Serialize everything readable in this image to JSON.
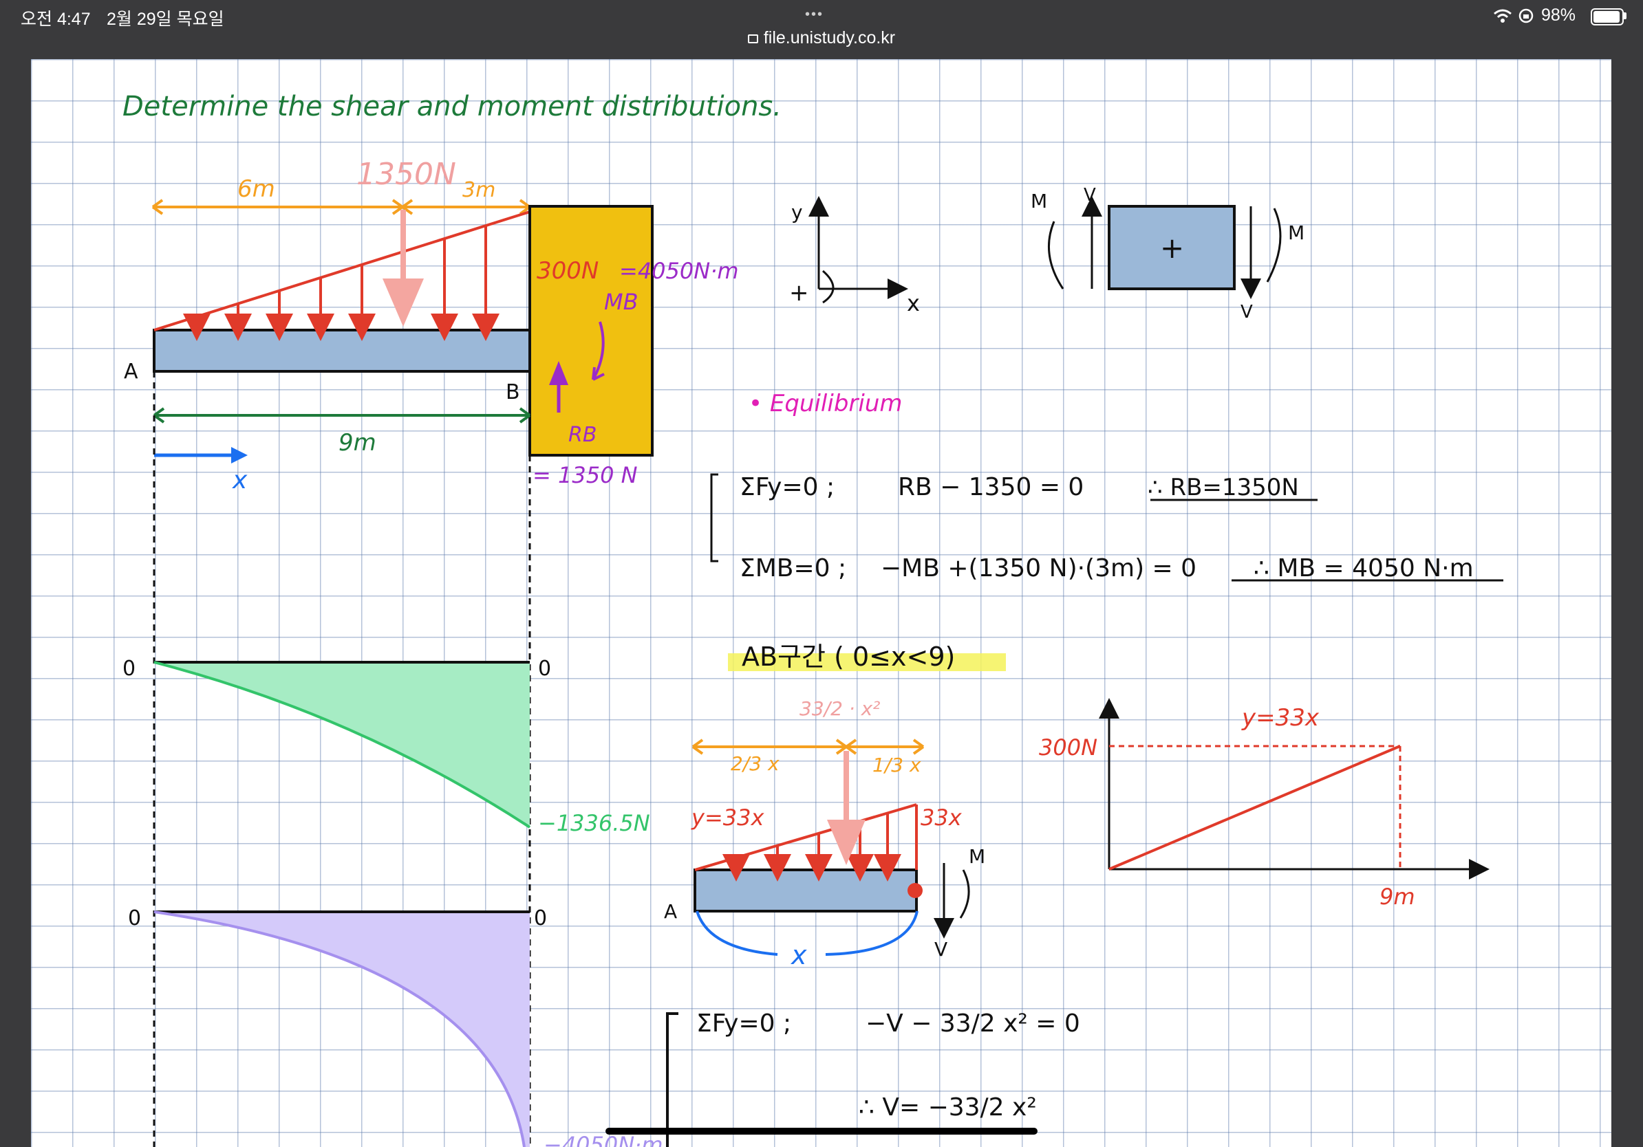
{
  "status_bar": {
    "time": "오전 4:47",
    "date": "2월 29일 목요일",
    "battery": "98%",
    "url": "file.unistudy.co.kr",
    "more_dots": "•••"
  },
  "note": {
    "title": "Determine the shear and moment distributions.",
    "beam": {
      "dim_left": "6m",
      "dim_right": "3m",
      "resultant": "1350N",
      "max_load": "300N",
      "wall_moment": "=4050N·m",
      "mb": "MB",
      "rb": "RB",
      "rb_value": "= 1350 N",
      "point_a": "A",
      "point_b": "B",
      "span": "9m",
      "x": "x"
    },
    "axes": {
      "y": "y",
      "x": "x",
      "plus": "+"
    },
    "sign": {
      "m_left": "M",
      "v_left": "V",
      "plus": "+",
      "m_right": "M",
      "v_right": "V"
    },
    "equilibrium": {
      "heading": "• Equilibrium",
      "eq1_left": "ΣFy=0 ;",
      "eq1_mid": "RB − 1350 = 0",
      "eq1_right": "∴ RB=1350N",
      "eq2_left": "ΣMB=0 ;",
      "eq2_mid": "−MB +(1350 N)·(3m) = 0",
      "eq2_right": "∴ MB = 4050 N·m"
    },
    "shear_diagram": {
      "zero_left": "0",
      "zero_right": "0",
      "end_value": "−1336.5N"
    },
    "moment_diagram": {
      "zero_left": "0",
      "zero_right": "0",
      "end_value": "−4050N·m"
    },
    "section": {
      "heading": "AB구간 ( 0≤x<9)",
      "resultant": "33/2 · x²",
      "two_thirds": "2/3 x",
      "one_third": "1/3 x",
      "load_label": "y=33x",
      "end_load": "33x",
      "m": "M",
      "v": "V",
      "a": "A",
      "x": "x"
    },
    "load_graph": {
      "label": "y=33x",
      "max": "300N",
      "length": "9m"
    },
    "section_eq": {
      "eq1": "ΣFy=0 ;",
      "eq1_rhs": "−V − 33/2 x² = 0",
      "result": "∴ V= −33/2 x²"
    }
  }
}
